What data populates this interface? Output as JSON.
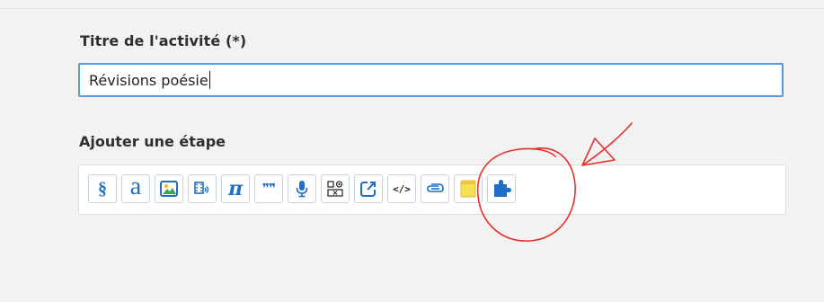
{
  "form": {
    "title_label": "Titre de l'activité (*)",
    "title_value": "Révisions poésie",
    "steps_label": "Ajouter une étape"
  },
  "toolbar": {
    "tools": [
      {
        "icon": "section-sign-icon",
        "glyph": "§"
      },
      {
        "icon": "text-a-icon",
        "glyph": "a"
      },
      {
        "icon": "image-icon"
      },
      {
        "icon": "video-icon"
      },
      {
        "icon": "pi-icon",
        "glyph": "π"
      },
      {
        "icon": "quote-icon",
        "glyph": "❞❞"
      },
      {
        "icon": "microphone-icon"
      },
      {
        "icon": "qcm-icon"
      },
      {
        "icon": "external-link-icon"
      },
      {
        "icon": "embed-code-icon",
        "glyph": "</>"
      },
      {
        "icon": "attachment-icon"
      },
      {
        "icon": "sticky-note-icon"
      },
      {
        "icon": "puzzle-icon"
      }
    ]
  },
  "colors": {
    "accent": "#1f6fc5",
    "input_border": "#5b9bd5",
    "annotation": "#e5302a",
    "sticky_note": "#f7df54"
  }
}
